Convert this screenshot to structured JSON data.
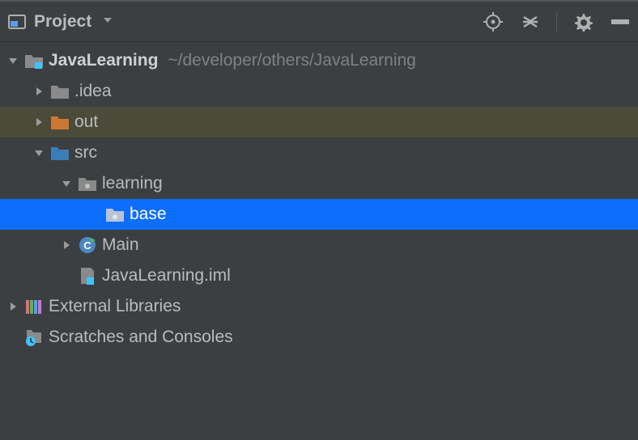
{
  "toolbar": {
    "title": "Project"
  },
  "tree": {
    "root": {
      "name": "JavaLearning",
      "hint": "~/developer/others/JavaLearning"
    },
    "idea": ".idea",
    "out": "out",
    "src": "src",
    "learning": "learning",
    "base": "base",
    "main": "Main",
    "iml": "JavaLearning.iml",
    "external": "External Libraries",
    "scratches": "Scratches and Consoles"
  }
}
